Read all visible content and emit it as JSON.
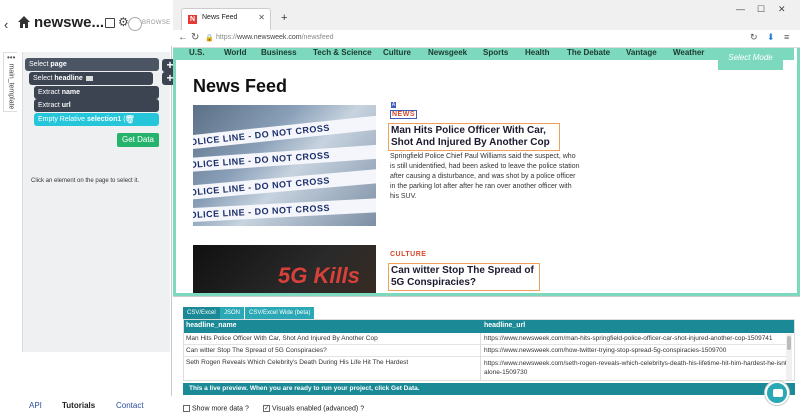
{
  "left": {
    "title": "newswe...",
    "browse": "BROWSE",
    "side_tab": "main_template",
    "nodes": {
      "page": {
        "prefix": "Select ",
        "name": "page"
      },
      "headline": {
        "prefix": "Select ",
        "name": "headline"
      },
      "name": {
        "prefix": "Extract ",
        "name": "name"
      },
      "url": {
        "prefix": "Extract ",
        "name": "url"
      },
      "relative": {
        "prefix": "Empty Relative ",
        "name": "selection1",
        "count": "(0)"
      }
    },
    "get_data": "Get Data",
    "hint": "Click an element on the page to select it.",
    "footer": {
      "api": "API",
      "tutorials": "Tutorials",
      "contact": "Contact"
    }
  },
  "browser": {
    "tab_title": "News Feed",
    "url_prefix": "https://",
    "url_host": "www.newsweek.com",
    "url_path": "/newsfeed"
  },
  "page": {
    "nav": [
      "U.S.",
      "World",
      "Business",
      "Tech & Science",
      "Culture",
      "Newsgeek",
      "Sports",
      "Health",
      "The Debate",
      "Vantage",
      "Weather"
    ],
    "select_mode": "Select Mode",
    "title": "News Feed",
    "articles": [
      {
        "category": "NEWS",
        "headline": "Man Hits Police Officer With Car, Shot And Injured By Another Cop",
        "summary": "Springfield Police Chief Paul Williams said the suspect, who is still unidentified, had been asked to leave the police station after causing a disturbance, and was shot by a police officer in the parking lot after after he ran over another officer with his SUV.",
        "image_text": "POLICE LINE - DO NOT CROSS"
      },
      {
        "category": "CULTURE",
        "headline": "Can witter Stop The Spread of 5G Conspiracies?",
        "image_text": "5G Kills"
      }
    ]
  },
  "preview": {
    "tabs": [
      "CSV/Excel",
      "JSON",
      "CSV/Excel Wide (beta)"
    ],
    "columns": [
      "headline_name",
      "headline_url"
    ],
    "rows": [
      [
        "Man Hits Police Officer With Car, Shot And Injured By Another Cop",
        "https://www.newsweek.com/man-hits-springfield-police-officer-car-shot-injured-another-cop-1509741"
      ],
      [
        "Can witter Stop The Spread of 5G Conspiracies?",
        "https://www.newsweek.com/how-twitter-trying-stop-spread-5g-conspiracies-1509700"
      ],
      [
        "Seth Rogen Reveals Which Celebrity's Death During His Life Hit The Hardest",
        "https://www.newsweek.com/seth-rogen-reveals-which-celebritys-death-his-lifetime-hit-him-hardest-he-isnt-alone-1509730"
      ]
    ],
    "note": "This a live preview. When you are ready to run your project, click Get Data.",
    "show_more": "Show more data",
    "visuals": "Visuals enabled (advanced)"
  }
}
